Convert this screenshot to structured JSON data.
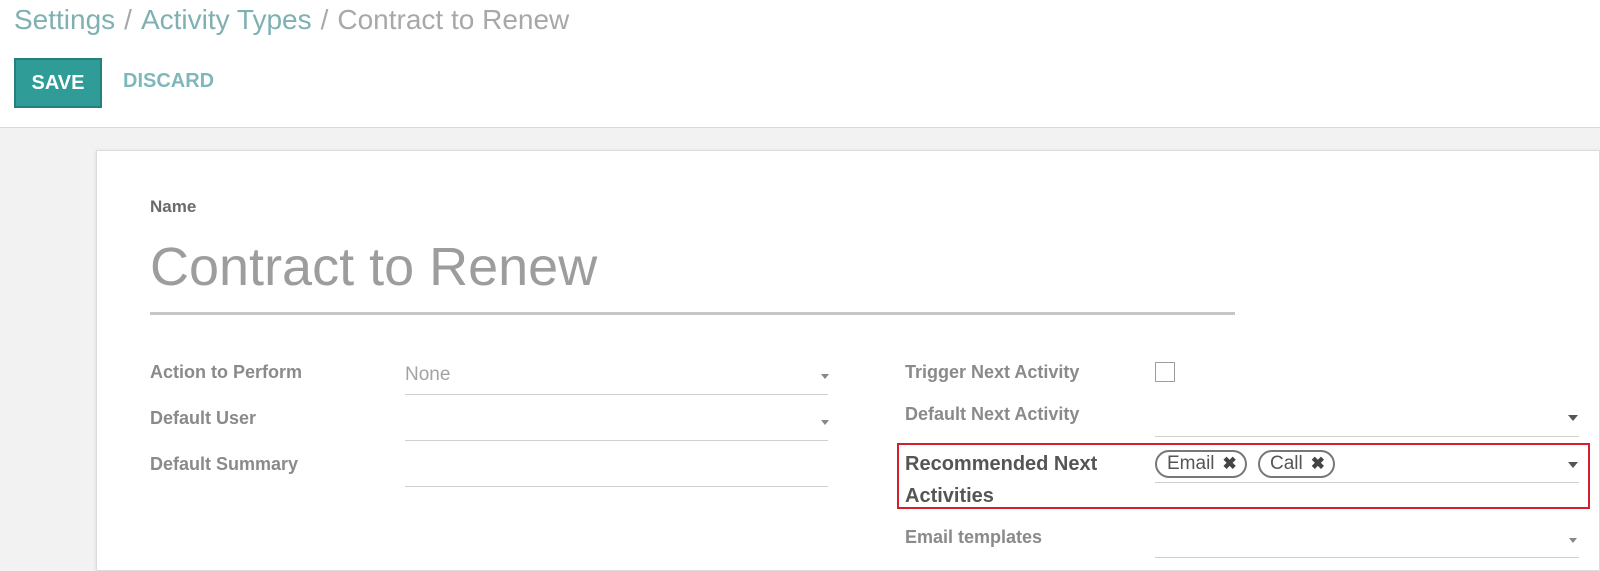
{
  "breadcrumb": {
    "items": [
      "Settings",
      "Activity Types"
    ],
    "current": "Contract to Renew",
    "separator": "/"
  },
  "toolbar": {
    "save_label": "SAVE",
    "discard_label": "DISCARD"
  },
  "form": {
    "name_label": "Name",
    "name_value": "Contract to Renew",
    "action_label": "Action to Perform",
    "action_value": "None",
    "default_user_label": "Default User",
    "default_user_value": "",
    "default_summary_label": "Default Summary",
    "default_summary_value": "",
    "trigger_next_label": "Trigger Next Activity",
    "trigger_next_checked": false,
    "default_next_label": "Default Next Activity",
    "default_next_value": "",
    "recommended_label": "Recommended Next Activities",
    "recommended_tags": [
      "Email",
      "Call"
    ],
    "email_templates_label": "Email templates",
    "email_templates_value": ""
  },
  "colors": {
    "primary": "#2f9c98",
    "highlight": "#d3202f"
  }
}
